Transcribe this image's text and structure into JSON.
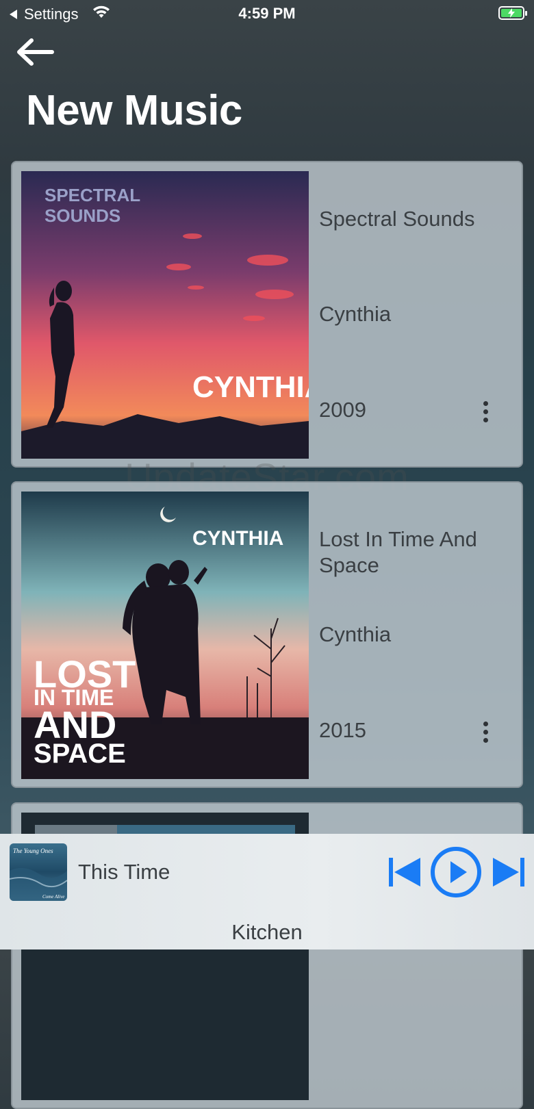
{
  "status_bar": {
    "back_app": "Settings",
    "time": "4:59 PM"
  },
  "header": {
    "title": "New Music"
  },
  "albums": [
    {
      "title": "Spectral Sounds",
      "artist": "Cynthia",
      "year": "2009",
      "art_top_text": "SPECTRAL SOUNDS",
      "art_bottom_text": "CYNTHIA"
    },
    {
      "title": "Lost In Time And Space",
      "artist": "Cynthia",
      "year": "2015",
      "art_top_text": "CYNTHIA",
      "art_bottom_text": "LOST IN TIME AND SPACE"
    }
  ],
  "watermark": "UpdateStar.com",
  "now_playing": {
    "track": "This Time",
    "device": "Kitchen",
    "thumb_top_text": "The Young Ones",
    "thumb_bottom_text": "Come Alive"
  },
  "colors": {
    "accent": "#1a7cf5",
    "battery": "#4cd964"
  },
  "icons": [
    "back-arrow-icon",
    "wifi-icon",
    "battery-icon",
    "more-vertical-icon",
    "skip-previous-icon",
    "play-icon",
    "skip-next-icon"
  ]
}
